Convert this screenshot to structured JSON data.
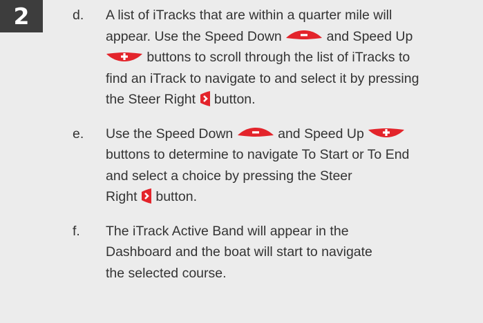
{
  "step_badge": "2",
  "steps": [
    {
      "letter": "d.",
      "lines": [
        [
          "A list of iTracks that are within a quarter mile will"
        ],
        [
          "appear. Use the Speed Down ",
          " and Speed Up"
        ],
        [
          "",
          " buttons to scroll through the list of iTracks to"
        ],
        [
          "find an iTrack to navigate to and select it by pressing"
        ],
        [
          "the Steer Right ",
          " button."
        ]
      ]
    },
    {
      "letter": "e.",
      "lines": [
        [
          "Use the Speed Down ",
          " and Speed Up "
        ],
        [
          "buttons to determine to navigate To Start or To End"
        ],
        [
          "and select a choice by pressing the Steer"
        ],
        [
          "Right ",
          " button."
        ]
      ]
    },
    {
      "letter": "f.",
      "lines": [
        [
          "The iTrack Active Band will appear in the"
        ],
        [
          "Dashboard and the boat will start to navigate"
        ],
        [
          "the selected course."
        ]
      ]
    }
  ],
  "icons": {
    "speed_down": "speed-down-button-icon",
    "speed_up": "speed-up-button-icon",
    "steer_right": "steer-right-button-icon"
  },
  "colors": {
    "button_red": "#e3242b",
    "badge_bg": "#3d3d3d",
    "text": "#333333",
    "page_bg": "#ececec"
  }
}
